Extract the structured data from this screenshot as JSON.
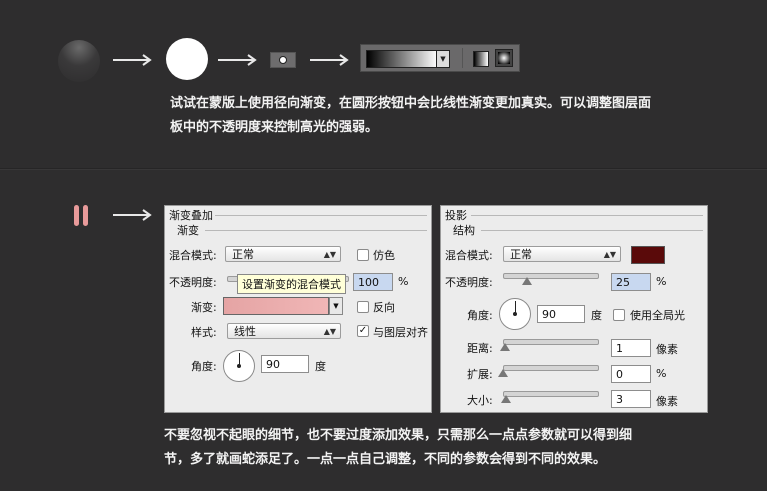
{
  "step1": {
    "caption_line1": "试试在蒙版上使用径向渐变，在圆形按钮中会比线性渐变更加真实。可以调整图层面",
    "caption_line2": "板中的不透明度来控制高光的强弱。"
  },
  "step2": {
    "gradient_panel": {
      "title": "渐变叠加",
      "group": "渐变",
      "blend_mode_label": "混合模式:",
      "blend_mode_value": "正常",
      "dither_label": "仿色",
      "opacity_label": "不透明度:",
      "opacity_value": "100",
      "percent": "%",
      "tooltip": "设置渐变的混合模式",
      "gradient_label": "渐变:",
      "reverse_label": "反向",
      "style_label": "样式:",
      "style_value": "线性",
      "align_label": "与图层对齐",
      "angle_label": "角度:",
      "angle_value": "90",
      "degree": "度"
    },
    "shadow_panel": {
      "title": "投影",
      "group": "结构",
      "blend_mode_label": "混合模式:",
      "blend_mode_value": "正常",
      "opacity_label": "不透明度:",
      "opacity_value": "25",
      "percent": "%",
      "angle_label": "角度:",
      "angle_value": "90",
      "degree": "度",
      "global_light_label": "使用全局光",
      "distance_label": "距离:",
      "distance_value": "1",
      "spread_label": "扩展:",
      "spread_value": "0",
      "size_label": "大小:",
      "size_value": "3",
      "px": "像素",
      "shadow_color": "#5a0a0a"
    },
    "caption_line1": "不要忽视不起眼的细节，也不要过度添加效果，只需那么一点点参数就可以得到细",
    "caption_line2": "节，多了就画蛇添足了。一点一点自己调整，不同的参数会得到不同的效果。"
  },
  "colors": {
    "background": "#2e2d2e",
    "pink_accent": "#e89a9a"
  }
}
